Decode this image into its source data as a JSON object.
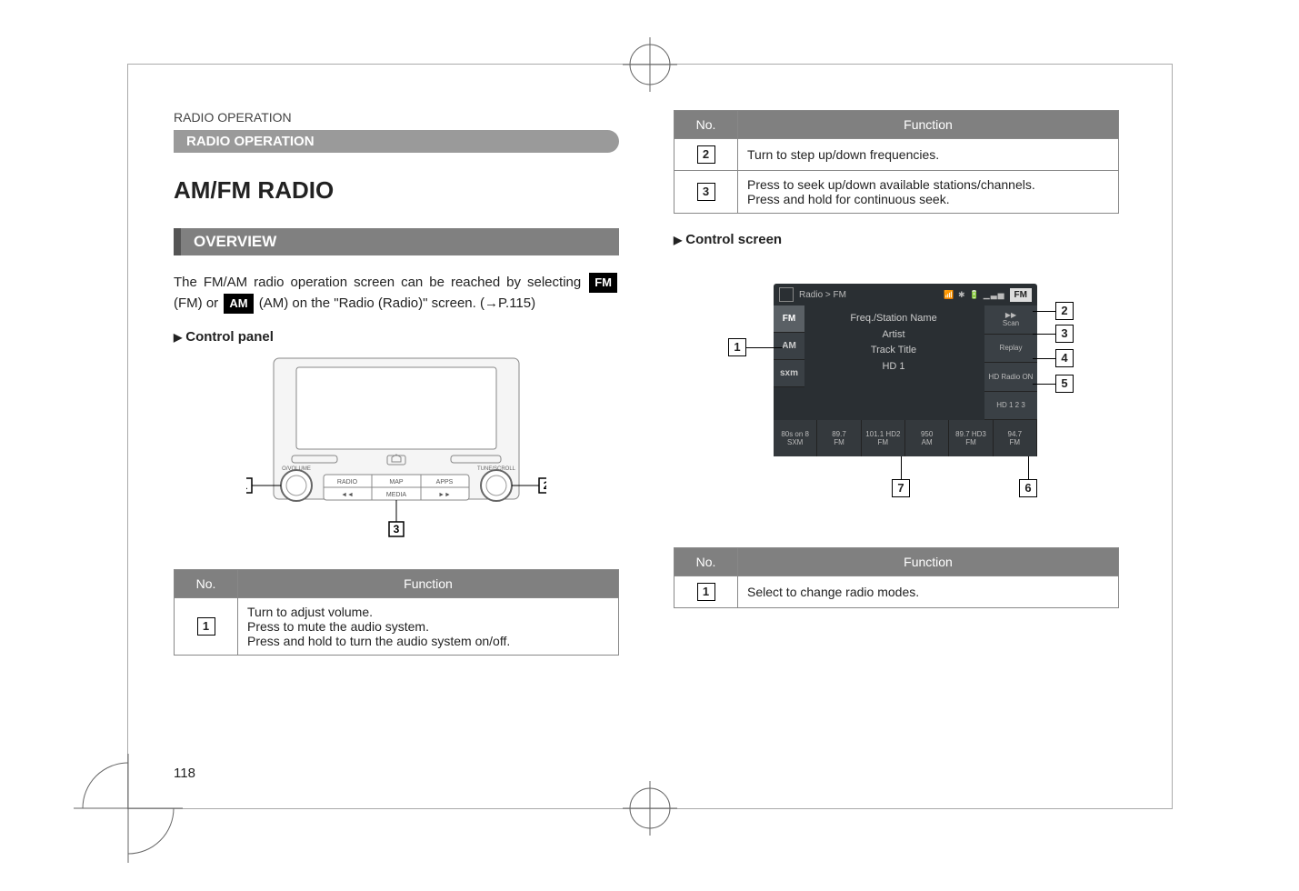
{
  "header": {
    "section": "RADIO OPERATION",
    "bar": "RADIO OPERATION"
  },
  "title": "AM/FM RADIO",
  "overview": {
    "heading": "OVERVIEW",
    "text_before": "The FM/AM radio operation screen can be reached by selecting ",
    "btn_fm": "FM",
    "mid_fm": " (FM) or ",
    "btn_am": "AM",
    "text_after": " (AM) on the \"Radio (Radio)\" screen. (→P.115)"
  },
  "control_panel": {
    "heading": "Control panel",
    "labels": {
      "volume_knob": "O/VOLUME",
      "tune_knob": "TUNE/SCROLL",
      "radio": "RADIO",
      "map": "MAP",
      "apps": "APPS",
      "media": "MEDIA"
    }
  },
  "panel_table": {
    "headers": {
      "no": "No.",
      "fn": "Function"
    },
    "row1": {
      "l1": "Turn to adjust volume.",
      "l2": "Press to mute the audio system.",
      "l3": "Press and hold to turn the audio system on/off."
    },
    "row2": "Turn to step up/down frequencies.",
    "row3": {
      "l1": "Press to seek up/down available stations/channels.",
      "l2": "Press and hold for continuous seek."
    }
  },
  "control_screen": {
    "heading": "Control screen",
    "breadcrumb": "Radio  >  FM",
    "status": "📶 ✱ 🔋 ▁▃▅",
    "fm_badge": "FM",
    "tabs": {
      "fm": "FM",
      "am": "AM",
      "sxm": "sxm"
    },
    "main": {
      "freq": "Freq./Station Name",
      "artist": "Artist",
      "track": "Track Title",
      "hd": "HD 1"
    },
    "right": {
      "scan": "Scan",
      "replay": "Replay",
      "hdradio": "HD Radio ON",
      "hdnums": "HD 1 2 3"
    },
    "presets": [
      {
        "top": "80s on 8",
        "bot": "SXM"
      },
      {
        "top": "89.7",
        "bot": "FM"
      },
      {
        "top": "101.1 HD2",
        "bot": "FM"
      },
      {
        "top": "950",
        "bot": "AM"
      },
      {
        "top": "89.7 HD3",
        "bot": "FM"
      },
      {
        "top": "94.7",
        "bot": "FM"
      }
    ]
  },
  "screen_table": {
    "headers": {
      "no": "No.",
      "fn": "Function"
    },
    "row1": "Select to change radio modes."
  },
  "page_number": "118"
}
